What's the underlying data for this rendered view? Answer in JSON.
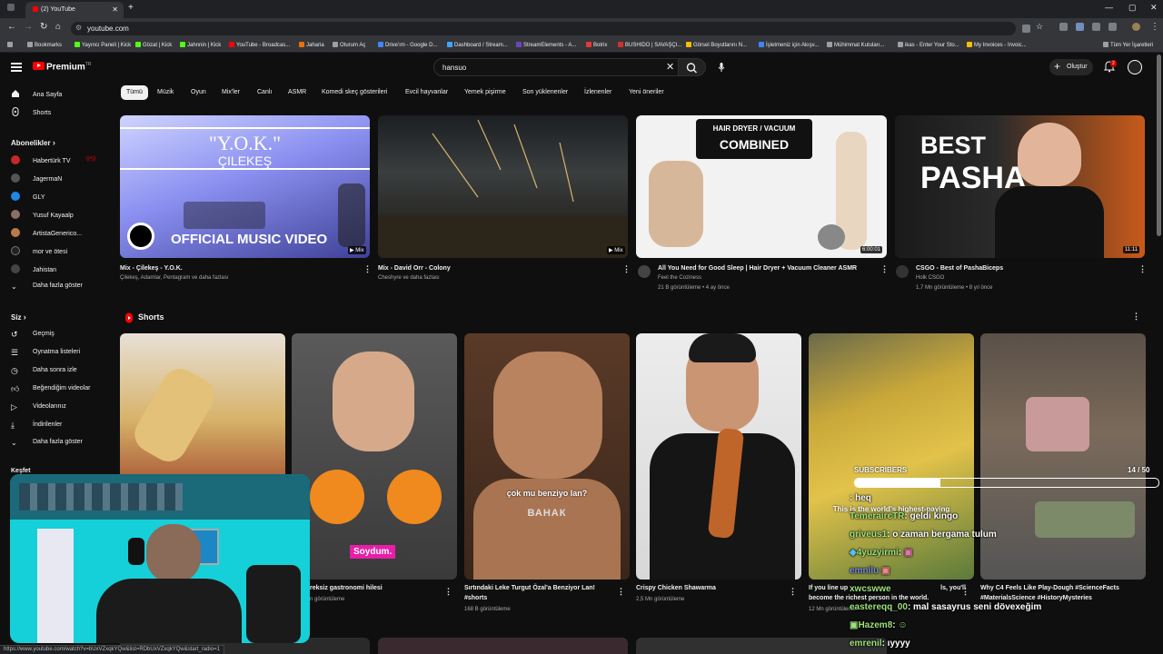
{
  "browser": {
    "tab_title": "(2) YouTube",
    "url": "youtube.com",
    "bookmarks": [
      "Bookmarks",
      "Yayıncı Paneli | Kick",
      "Gözat | Kick",
      "Jahnnin | Kick",
      "YouTube - Broadcas...",
      "Jaharia",
      "Oturum Aç",
      "Drive'ım - Google D...",
      "Dashboard / Stream...",
      "StreamElements - A...",
      "Botrix",
      "BUSHIDO | SAVAŞÇI...",
      "Görsel Boyutlarını N...",
      "İşletmeniz için Akışv...",
      "Mühimmat Kutuları...",
      "ikas - Enter Your Sto...",
      "My Invoices - Invoic..."
    ],
    "all_bookmarks": "Tüm Yer İşaretleri",
    "status_url": "https://www.youtube.com/watch?v=bUxVZxqkYQw&list=RDbUxVZxqkYQw&start_radio=1"
  },
  "header": {
    "logo_text": "Premium",
    "logo_sup": "TR",
    "search_value": "hansuo",
    "create_label": "Oluştur",
    "notif_count": "2"
  },
  "chips": [
    "Tümü",
    "Müzik",
    "Oyun",
    "Mix'ler",
    "Canlı",
    "ASMR",
    "Komedi skeç gösterileri",
    "Evcil hayvanlar",
    "Yemek pişirme",
    "Son yüklenenler",
    "İzlenenler",
    "Yeni öneriler"
  ],
  "sidebar": {
    "home": "Ana Sayfa",
    "shorts": "Shorts",
    "subs_header": "Abonelikler",
    "subs": [
      "Habertürk TV",
      "JagermaN",
      "GLY",
      "Yusuf Kayaalp",
      "ArtistaGenerico...",
      "mor ve ötesi",
      "Jahistan"
    ],
    "subs_more": "Daha fazla göster",
    "you_header": "Siz",
    "you": [
      "Geçmiş",
      "Oynatma listeleri",
      "Daha sonra izle",
      "Beğendiğim videolar",
      "Videolarınız",
      "İndirilenler"
    ],
    "you_more": "Daha fazla göster",
    "explore": "Keşfet"
  },
  "videos": [
    {
      "title": "Mix - Çilekeş - Y.O.K.",
      "meta": "Çilekeş, Adamlar, Pentagram ve daha fazlası",
      "badge": "Mix",
      "overlay_top": "\"Y.O.K.\"",
      "overlay_sub": "ÇILEKEŞ",
      "overlay_bottom": "OFFICIAL MUSIC VIDEO"
    },
    {
      "title": "Mix - David Orr - Colony",
      "meta": "Cheshyre ve daha fazlası",
      "badge": "Mix"
    },
    {
      "title": "All You Need for Good Sleep | Hair Dryer + Vacuum Cleaner ASMR",
      "channel": "Feel the Coziness",
      "meta": "21 B görüntüleme • 4 ay önce",
      "duration": "6:00:01",
      "overlay_top": "HAIR DRYER / VACUUM",
      "overlay_sub": "COMBINED"
    },
    {
      "title": "CSGO - Best of PashaBiceps",
      "channel": "Holk CSGO",
      "meta": "1,7 Mn görüntüleme • 8 yıl önce",
      "duration": "11:11",
      "overlay_top": "BEST",
      "overlay_sub": "PASHA"
    }
  ],
  "shorts": {
    "header": "Shorts",
    "items": [
      {
        "title": "",
        "views": ""
      },
      {
        "title": "reksiz gastronomi hilesi",
        "views": "n görüntüleme",
        "caption": "Soydum."
      },
      {
        "title": "Sırtındaki Leke Turgut Özal'a Benziyor Lan!",
        "title2": "#shorts",
        "views": "168 B görüntüleme",
        "caption": "çok mu benziyo lan?",
        "caption2": "ВАНАК"
      },
      {
        "title": "Crispy Chicken Shawarma",
        "views": "2,5 Mn görüntüleme"
      },
      {
        "title": "If you line up",
        "title_tail": "ls, you'll",
        "title2": "become the richest person in the world.",
        "views": "12 Mn görüntüleme",
        "caption": "This is the world's highest-paying"
      },
      {
        "title": "Why C4 Feels Like Play-Dough #ScienceFacts",
        "title2": "#MaterialsScience #HistoryMysteries",
        "views": ""
      }
    ]
  },
  "stream_overlay": {
    "subs_label": "SUBSCRIBERS",
    "subs_count": "14 / 50",
    "subs_progress": 0.28,
    "chat": [
      {
        "name": "",
        "msg": ": heq"
      },
      {
        "name": "TemerairєTR",
        "msg": ": geldi kingo"
      },
      {
        "name": "griveus1",
        "msg": ": o zaman bergama tulum"
      },
      {
        "name": "4yuzyirmi",
        "msg": ": "
      },
      {
        "name": "xwcswwe",
        "msg": ""
      },
      {
        "name": "eastereqq_00",
        "msg": ": mal sasayrus seni dövexeğim"
      },
      {
        "name": "Hazem8",
        "msg": ": "
      },
      {
        "name": "emrenil",
        "msg": ": ıyyyy"
      }
    ]
  },
  "colors": {
    "accent": "#ff0000",
    "bg": "#0f0f0f",
    "text": "#f1f1f1",
    "meta": "#aaaaaa"
  }
}
